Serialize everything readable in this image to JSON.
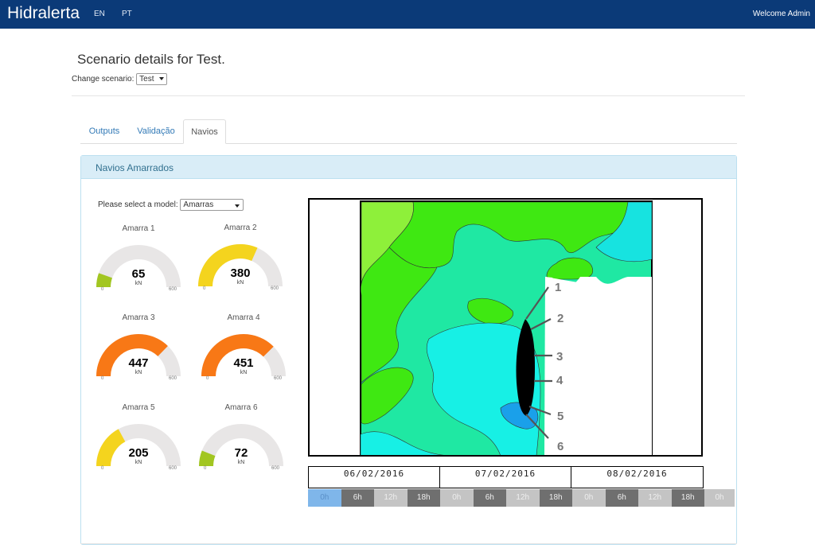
{
  "navbar": {
    "brand": "Hidralerta",
    "languages": [
      "EN",
      "PT"
    ],
    "welcome": "Welcome Admin"
  },
  "header": {
    "title": "Scenario details for Test.",
    "change_label": "Change scenario:",
    "scenario_selected": "Test"
  },
  "tabs": [
    {
      "label": "Outputs",
      "active": false
    },
    {
      "label": "Validação",
      "active": false
    },
    {
      "label": "Navios",
      "active": true
    }
  ],
  "panel": {
    "title": "Navios Amarrados",
    "model_label": "Please select a model:",
    "model_selected": "Amarras"
  },
  "gauges": [
    {
      "title": "Amarra 1",
      "value": "65",
      "unit": "kN",
      "min": "0",
      "max": "600",
      "level": 0.108,
      "color": "#a2c621"
    },
    {
      "title": "Amarra 2",
      "value": "380",
      "unit": "kN",
      "min": "0",
      "max": "600",
      "level": 0.633,
      "color": "#f4d41e"
    },
    {
      "title": "Amarra 3",
      "value": "447",
      "unit": "kN",
      "min": "0",
      "max": "600",
      "level": 0.745,
      "color": "#f87816"
    },
    {
      "title": "Amarra 4",
      "value": "451",
      "unit": "kN",
      "min": "0",
      "max": "600",
      "level": 0.752,
      "color": "#f87816"
    },
    {
      "title": "Amarra 5",
      "value": "205",
      "unit": "kN",
      "min": "0",
      "max": "600",
      "level": 0.342,
      "color": "#f4d41e"
    },
    {
      "title": "Amarra 6",
      "value": "72",
      "unit": "kN",
      "min": "0",
      "max": "600",
      "level": 0.12,
      "color": "#a2c621"
    }
  ],
  "map": {
    "mooring_labels": [
      "1",
      "2",
      "3",
      "4",
      "5",
      "6"
    ]
  },
  "timeline": {
    "dates": [
      "06/02/2016",
      "07/02/2016",
      "08/02/2016"
    ],
    "hours": [
      "0h",
      "6h",
      "12h",
      "18h",
      "0h",
      "6h",
      "12h",
      "18h",
      "0h",
      "6h",
      "12h",
      "18h",
      "0h"
    ],
    "selected_index": 0
  },
  "colors": {
    "navbar": "#0b3a78",
    "panel_header": "#d9edf7",
    "gauge_track": "#e8e6e6",
    "hour_selected": "#7fb6ea"
  }
}
